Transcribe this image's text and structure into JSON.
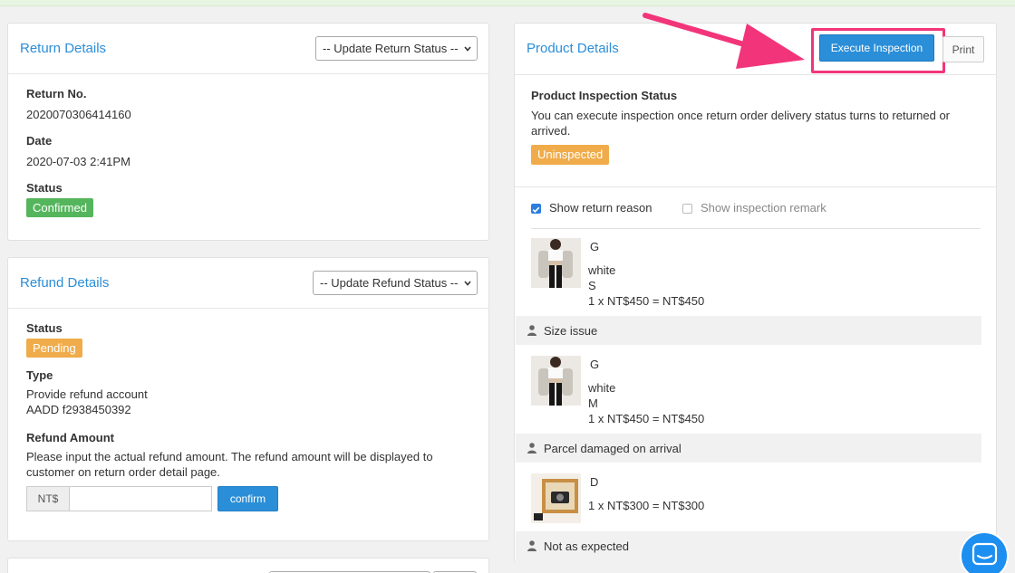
{
  "return_details": {
    "title": "Return Details",
    "status_select": "-- Update Return Status --",
    "return_no_label": "Return No.",
    "return_no": "2020070306414160",
    "date_label": "Date",
    "date": "2020-07-03 2:41PM",
    "status_label": "Status",
    "status": "Confirmed"
  },
  "refund_details": {
    "title": "Refund Details",
    "status_select": "-- Update Refund Status --",
    "status_label": "Status",
    "status": "Pending",
    "type_label": "Type",
    "type_line1": "Provide refund account",
    "type_line2": "AADD f2938450392",
    "amount_label": "Refund Amount",
    "amount_help_line1": "Please input the actual refund amount. The refund amount will be displayed to",
    "amount_help_line2": "customer on return order detail page.",
    "currency_prefix": "NT$",
    "amount_value": "",
    "confirm_label": "confirm"
  },
  "product_details": {
    "title": "Product Details",
    "execute_label": "Execute Inspection",
    "print_label": "Print",
    "inspection_status_label": "Product Inspection Status",
    "inspection_help_line1": "You can execute inspection once return order delivery status turns to returned or",
    "inspection_help_line2": "arrived.",
    "inspection_status": "Uninspected",
    "show_return_reason": "Show return reason",
    "show_return_reason_checked": true,
    "show_inspection_remark": "Show inspection remark",
    "show_inspection_remark_checked": false,
    "items": [
      {
        "name": "G",
        "color": "white",
        "size": "S",
        "price_line": "1 x NT$450 = NT$450",
        "reason": "Size issue"
      },
      {
        "name": "G",
        "color": "white",
        "size": "M",
        "price_line": "1 x NT$450 = NT$450",
        "reason": "Parcel damaged on arrival"
      },
      {
        "name": "D",
        "price_line": "1 x NT$300 = NT$300",
        "reason": "Not as expected"
      }
    ]
  },
  "colors": {
    "accent": "#2b8ed8",
    "success": "#55b55c",
    "warning": "#f0ac4a",
    "highlight": "#f2357a"
  }
}
